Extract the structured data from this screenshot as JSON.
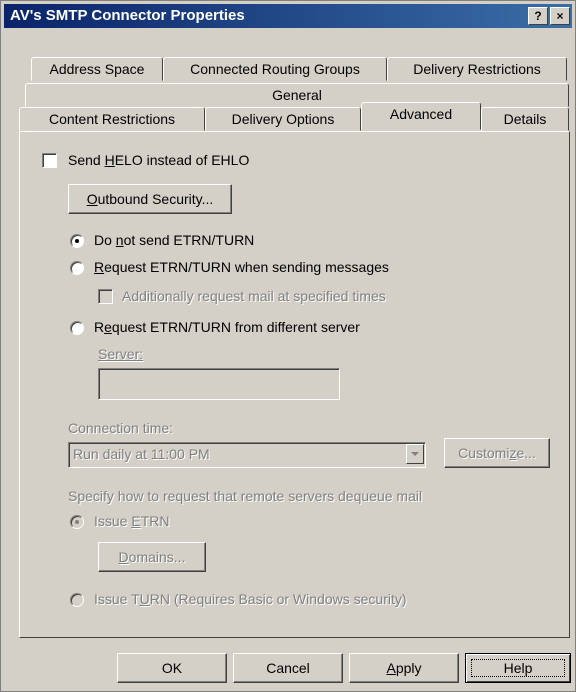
{
  "window": {
    "title": "AV's SMTP Connector Properties",
    "help_glyph": "?",
    "close_glyph": "×"
  },
  "tabs": {
    "row1": [
      "Address Space",
      "Connected Routing Groups",
      "Delivery Restrictions"
    ],
    "row2": [
      "General"
    ],
    "row3": [
      "Content Restrictions",
      "Delivery Options",
      "Advanced",
      "Details"
    ],
    "active": "Advanced"
  },
  "advanced": {
    "helo": {
      "pre": "Send ",
      "key": "H",
      "post": "ELO instead of EHLO",
      "checked": false
    },
    "outbound": {
      "key": "O",
      "post": "utbound Security..."
    },
    "etrn_options": {
      "none": {
        "pre": "Do ",
        "key": "n",
        "post": "ot send ETRN/TURN",
        "selected": true
      },
      "when_sending": {
        "key": "R",
        "post": "equest ETRN/TURN when sending messages",
        "selected": false
      },
      "additionally": {
        "label": "Additionally request mail at specified times",
        "checked": false
      },
      "different_server": {
        "pre": "R",
        "key": "e",
        "post": "quest ETRN/TURN from different server",
        "selected": false
      }
    },
    "server": {
      "label": "Server:",
      "value": ""
    },
    "connection_time": {
      "label": "Connection time:",
      "value": "Run daily at 11:00 PM",
      "customize_pre": "Customi",
      "customize_key": "z",
      "customize_post": "e..."
    },
    "dequeue": {
      "label": "Specify how to request that remote servers dequeue mail",
      "issue_etrn": {
        "pre": "Issue ",
        "key": "E",
        "post": "TRN",
        "selected": true
      },
      "domains": {
        "key": "D",
        "post": "omains..."
      },
      "issue_turn": {
        "pre": "Issue T",
        "key": "U",
        "post": "RN (Requires Basic or Windows security)",
        "selected": false
      }
    }
  },
  "buttons": {
    "ok": "OK",
    "cancel": "Cancel",
    "apply_key": "A",
    "apply_post": "pply",
    "help": "Help"
  }
}
